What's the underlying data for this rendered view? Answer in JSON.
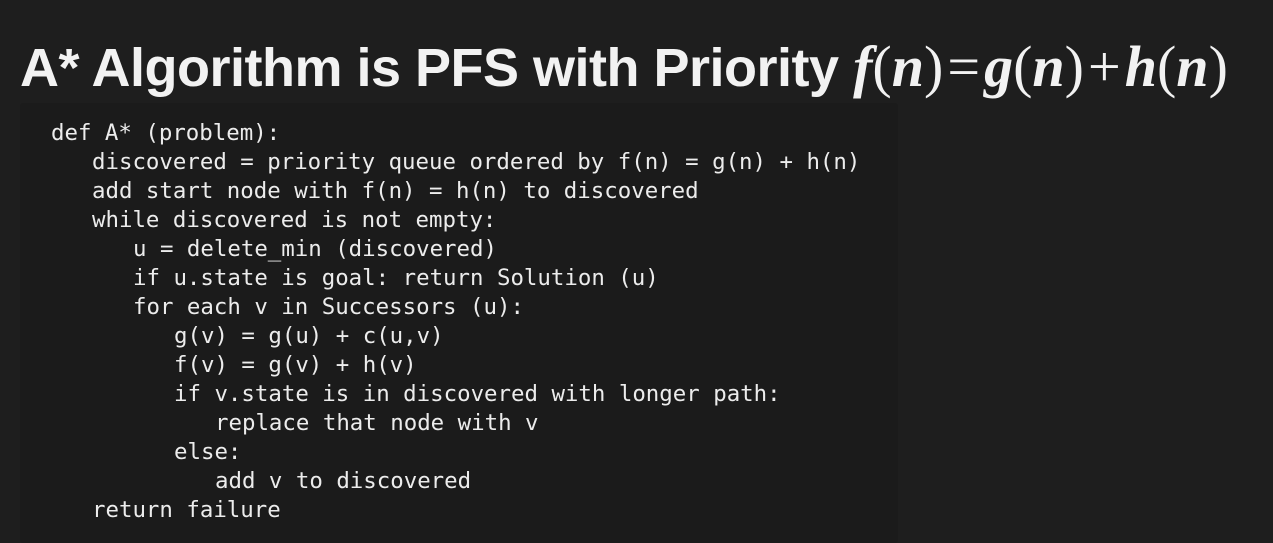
{
  "slide": {
    "title_text": "A* Algorithm is PFS with Priority",
    "formula": {
      "f": "f",
      "n1": "n",
      "equals": "=",
      "g": "g",
      "n2": "n",
      "plus": "+",
      "h": "h",
      "n3": "n",
      "lparen": "(",
      "rparen": ")"
    }
  },
  "code": {
    "lines": [
      "def A* (problem):",
      "discovered = priority queue ordered by f(n) = g(n) + h(n)",
      "add start node with f(n) = h(n) to discovered",
      "while discovered is not empty:",
      "u = delete_min (discovered)",
      "if u.state is goal: return Solution (u)",
      "for each v in Successors (u):",
      "g(v) = g(u) + c(u,v)",
      "f(v) = g(v) + h(v)",
      "if v.state is in discovered with longer path:",
      "replace that node with v",
      "else:",
      "add v to discovered",
      "return failure"
    ]
  }
}
